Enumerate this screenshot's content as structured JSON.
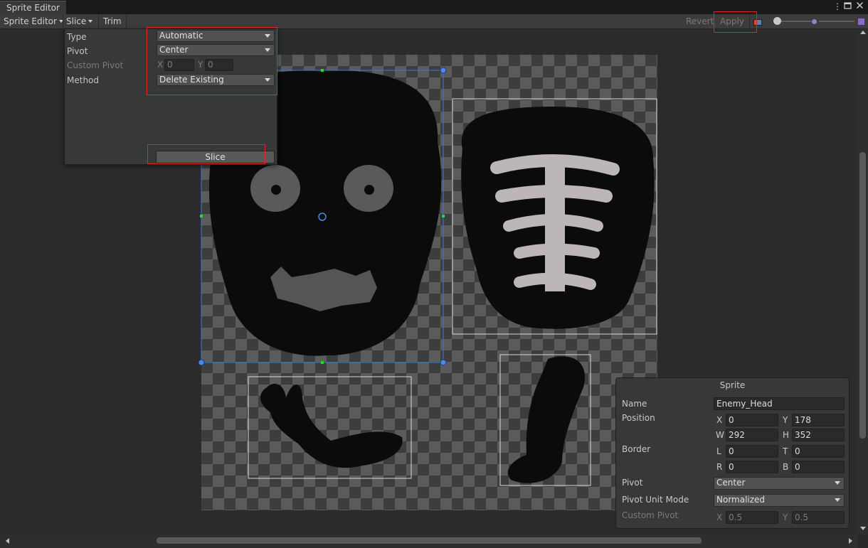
{
  "window": {
    "tab_title": "Sprite Editor",
    "menu_icon": "kebab-menu-icon",
    "maximize_icon": "maximize-icon",
    "close_icon": "close-icon"
  },
  "toolbar": {
    "sprite_editor_label": "Sprite Editor",
    "slice_label": "Slice",
    "trim_label": "Trim",
    "revert_label": "Revert",
    "apply_label": "Apply",
    "color_toggle_icon": "rgb-channel-icon",
    "zoom_slider_value": 0.1,
    "mip_slider_value": 0.5
  },
  "slice_panel": {
    "type_label": "Type",
    "type_value": "Automatic",
    "pivot_label": "Pivot",
    "pivot_value": "Center",
    "custom_pivot_label": "Custom Pivot",
    "custom_pivot_x_label": "X",
    "custom_pivot_x": "0",
    "custom_pivot_y_label": "Y",
    "custom_pivot_y": "0",
    "method_label": "Method",
    "method_value": "Delete Existing",
    "slice_button": "Slice"
  },
  "sprite_panel": {
    "title": "Sprite",
    "name_label": "Name",
    "name_value": "Enemy_Head",
    "position_label": "Position",
    "x_label": "X",
    "x_value": "0",
    "y_label": "Y",
    "y_value": "178",
    "w_label": "W",
    "w_value": "292",
    "h_label": "H",
    "h_value": "352",
    "border_label": "Border",
    "l_label": "L",
    "l_value": "0",
    "t_label": "T",
    "t_value": "0",
    "r_label": "R",
    "r_value": "0",
    "b_label": "B",
    "b_value": "0",
    "pivot_label": "Pivot",
    "pivot_value": "Center",
    "pivot_unit_label": "Pivot Unit Mode",
    "pivot_unit_value": "Normalized",
    "custom_pivot_label": "Custom Pivot",
    "cp_x_label": "X",
    "cp_x_value": "0.5",
    "cp_y_label": "Y",
    "cp_y_value": "0.5"
  },
  "colors": {
    "highlight": "#e0262b",
    "selection": "#3a7ad6",
    "handle": "#22dd22"
  }
}
